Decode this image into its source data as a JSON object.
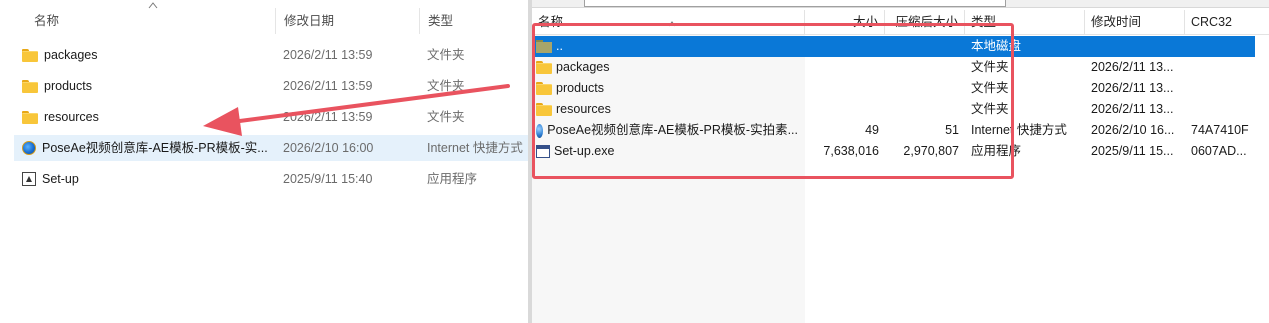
{
  "explorer": {
    "columns": {
      "name": "名称",
      "date": "修改日期",
      "type": "类型"
    },
    "rows": [
      {
        "name": "packages",
        "date": "2026/2/11 13:59",
        "type": "文件夹",
        "icon": "folder-icon"
      },
      {
        "name": "products",
        "date": "2026/2/11 13:59",
        "type": "文件夹",
        "icon": "folder-icon"
      },
      {
        "name": "resources",
        "date": "2026/2/11 13:59",
        "type": "文件夹",
        "icon": "folder-icon"
      },
      {
        "name": "PoseAe视频创意库-AE模板-PR模板-实...",
        "date": "2026/2/10 16:00",
        "type": "Internet 快捷方式",
        "icon": "internet-shortcut-icon",
        "highlighted": true
      },
      {
        "name": "Set-up",
        "date": "2025/9/11 15:40",
        "type": "应用程序",
        "icon": "app-icon"
      }
    ]
  },
  "archive": {
    "columns": {
      "name": "名称",
      "size": "大小",
      "packed": "压缩后大小",
      "type": "类型",
      "modified": "修改时间",
      "crc": "CRC32"
    },
    "rows": [
      {
        "name": "..",
        "size": "",
        "packed": "",
        "type": "本地磁盘",
        "modified": "",
        "crc": "",
        "icon": "up-folder-icon",
        "selected": true
      },
      {
        "name": "packages",
        "size": "",
        "packed": "",
        "type": "文件夹",
        "modified": "2026/2/11 13...",
        "crc": "",
        "icon": "folder-icon"
      },
      {
        "name": "products",
        "size": "",
        "packed": "",
        "type": "文件夹",
        "modified": "2026/2/11 13...",
        "crc": "",
        "icon": "folder-icon"
      },
      {
        "name": "resources",
        "size": "",
        "packed": "",
        "type": "文件夹",
        "modified": "2026/2/11 13...",
        "crc": "",
        "icon": "folder-icon"
      },
      {
        "name": "PoseAe视频创意库-AE模板-PR模板-实拍素...",
        "size": "49",
        "packed": "51",
        "type": "Internet 快捷方式",
        "modified": "2026/2/10 16...",
        "crc": "74A7410F",
        "icon": "globe-icon"
      },
      {
        "name": "Set-up.exe",
        "size": "7,638,016",
        "packed": "2,970,807",
        "type": "应用程序",
        "modified": "2025/9/11 15...",
        "crc": "0607AD...",
        "icon": "exe-icon"
      }
    ]
  },
  "colors": {
    "annotation": "#e9535f",
    "selection": "#0a78d7",
    "hover": "#e5f1fb"
  }
}
